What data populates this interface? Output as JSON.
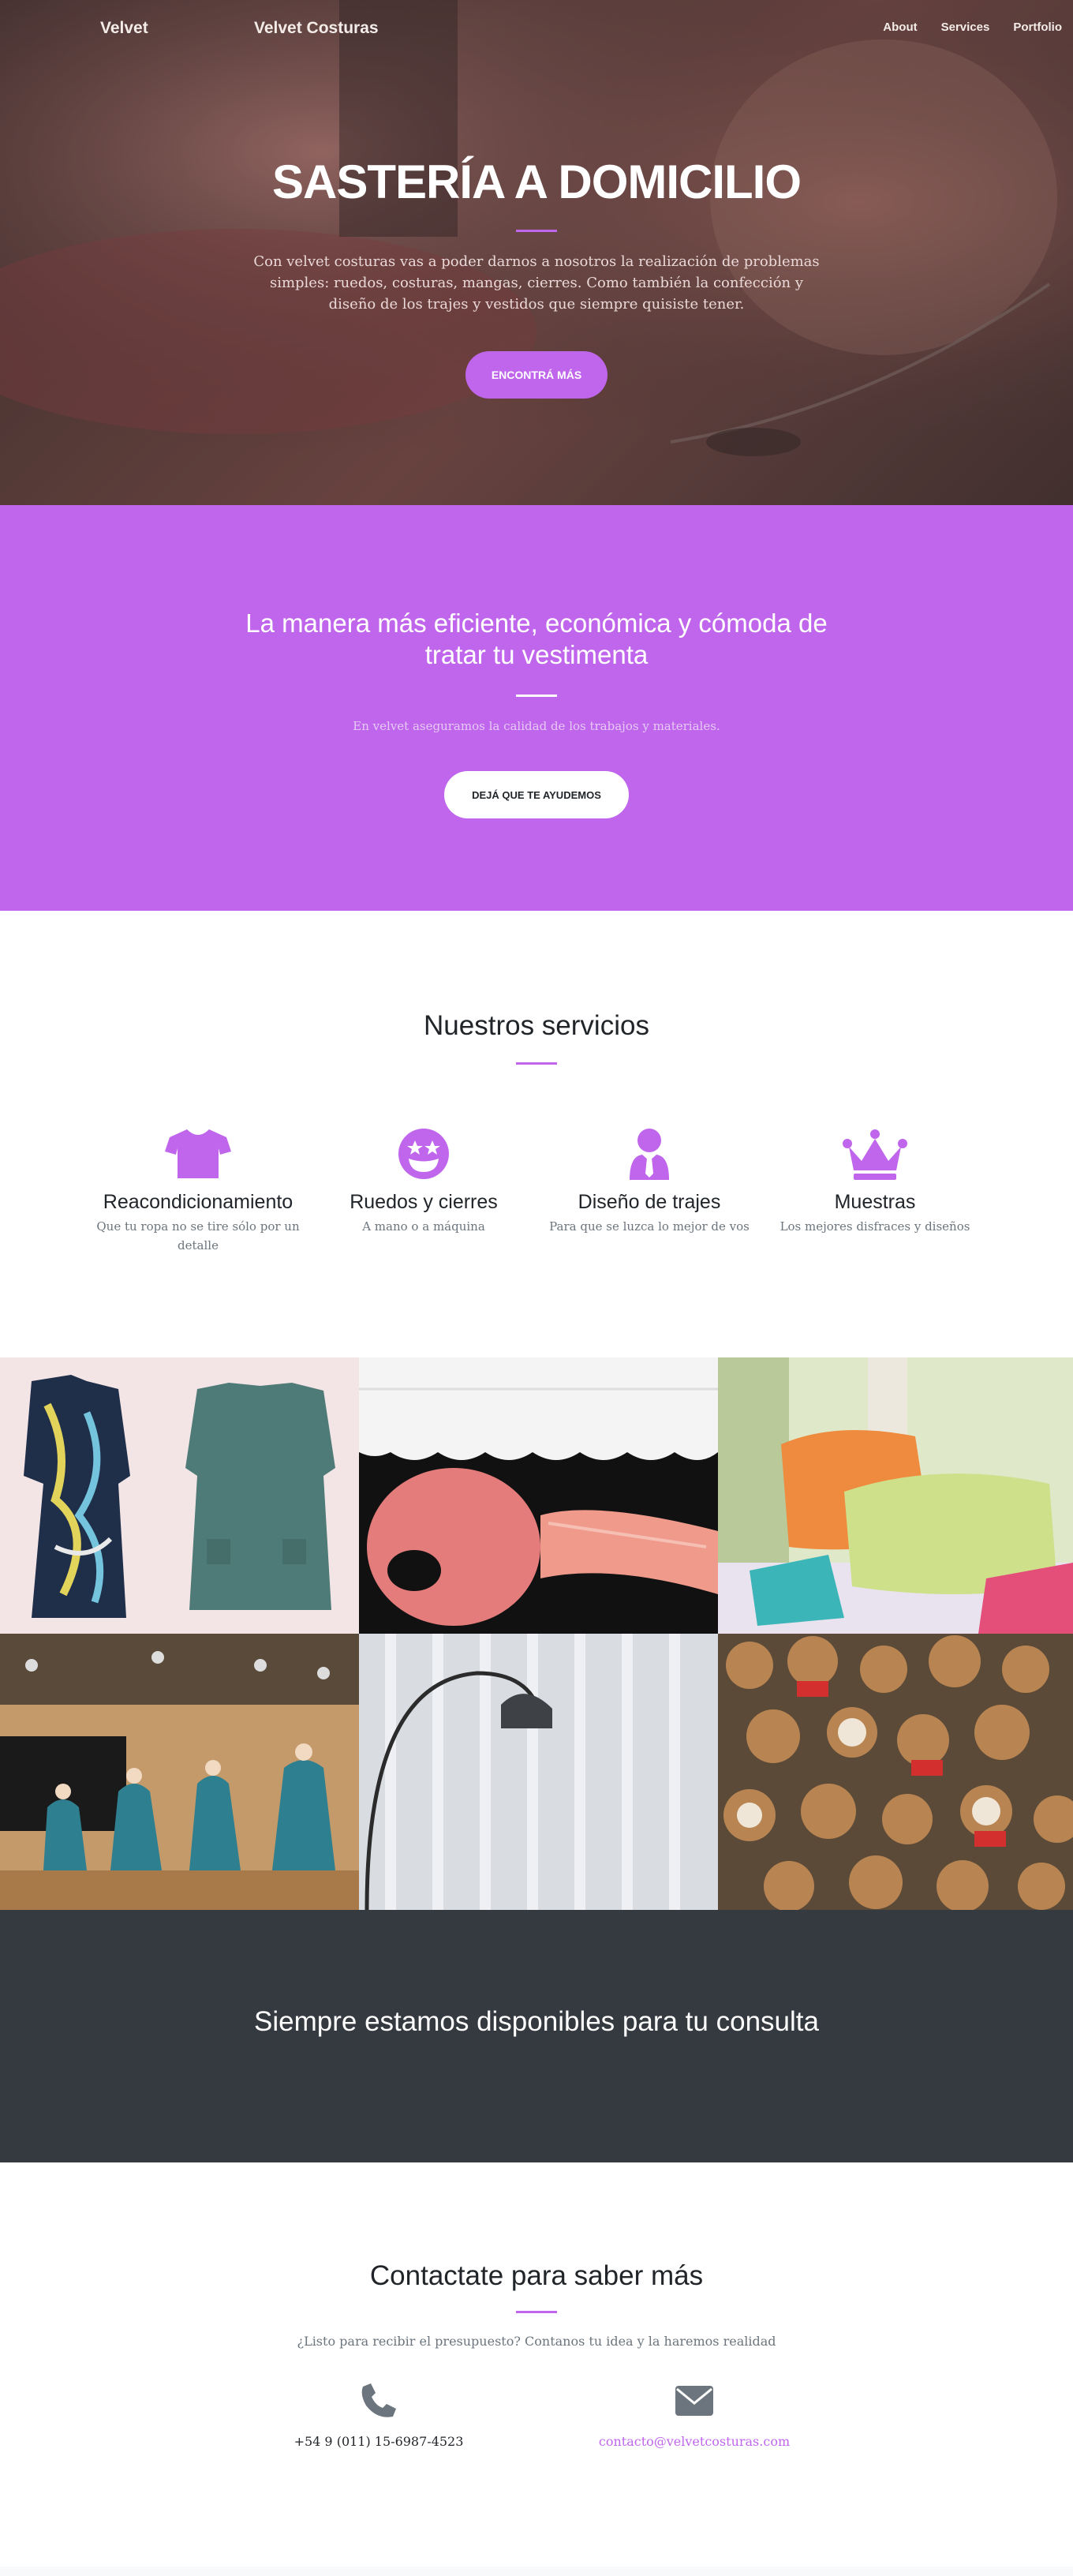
{
  "nav": {
    "brand_left": "Velvet",
    "brand_center": "Velvet Costuras",
    "links": [
      "About",
      "Services",
      "Portfolio"
    ]
  },
  "hero": {
    "title": "SASTERÍA A DOMICILIO",
    "text": "Con velvet costuras vas a poder darnos a nosotros la realización de problemas simples: ruedos, costuras, mangas, cierres. Como también la confección y diseño de los trajes y vestidos que siempre quisiste tener.",
    "button": "ENCONTRÁ MÁS"
  },
  "about": {
    "title": "La manera más eficiente, económica y cómoda de tratar tu vestimenta",
    "text": "En velvet aseguramos la calidad de los trabajos y materiales.",
    "button": "DEJÁ QUE TE AYUDEMOS"
  },
  "services": {
    "title": "Nuestros servicios",
    "items": [
      {
        "icon": "shirt-icon",
        "title": "Reacondicionamiento",
        "text": "Que tu ropa no se tire sólo por un detalle"
      },
      {
        "icon": "grin-stars-icon",
        "title": "Ruedos y cierres",
        "text": "A mano o a máquina"
      },
      {
        "icon": "user-tie-icon",
        "title": "Diseño de trajes",
        "text": "Para que se luzca lo mejor de vos"
      },
      {
        "icon": "crown-icon",
        "title": "Muestras",
        "text": "Los mejores disfraces y diseños"
      }
    ]
  },
  "portfolio": {
    "tiles": [
      "dresses",
      "elastic-ribbons",
      "cushions",
      "folk-dancers",
      "curtain-lamp",
      "teddy-bears"
    ]
  },
  "cta": {
    "title": "Siempre estamos disponibles para tu consulta"
  },
  "contact": {
    "title": "Contactate para saber más",
    "lead": "¿Listo para recibir el presupuesto? Contanos tu idea y la haremos realidad",
    "phone": "+54 9 (011) 15-6987-4523",
    "email": "contacto@velvetcosturas.com"
  },
  "colors": {
    "accent": "#c066ec",
    "dark": "#343a40",
    "icon_gray": "#6c757d"
  }
}
